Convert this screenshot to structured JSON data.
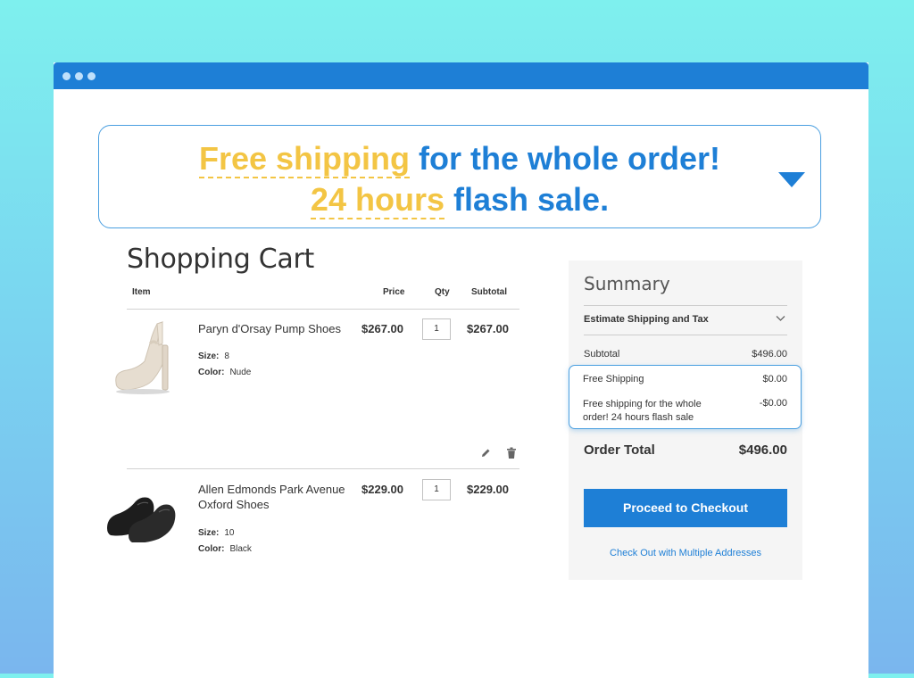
{
  "banner": {
    "line1_highlight": "Free shipping",
    "line1_rest": "for the whole order!",
    "line2_highlight": "24 hours",
    "line2_rest": "flash sale."
  },
  "cart": {
    "title": "Shopping Cart",
    "headers": {
      "item": "Item",
      "price": "Price",
      "qty": "Qty",
      "subtotal": "Subtotal"
    },
    "items": [
      {
        "name": "Paryn d'Orsay Pump Shoes",
        "size_label": "Size:",
        "size": "8",
        "color_label": "Color:",
        "color": "Nude",
        "price": "$267.00",
        "qty": "1",
        "subtotal": "$267.00"
      },
      {
        "name_line1": "Allen Edmonds Park Avenue",
        "name_line2": "Oxford Shoes",
        "size_label": "Size:",
        "size": "10",
        "color_label": "Color:",
        "color": "Black",
        "price": "$229.00",
        "qty": "1",
        "subtotal": "$229.00"
      }
    ],
    "icons": {
      "edit": "pencil-icon",
      "delete": "trash-icon"
    }
  },
  "summary": {
    "title": "Summary",
    "estimate": "Estimate Shipping and Tax",
    "subtotal_label": "Subtotal",
    "subtotal_value": "$496.00",
    "free_shipping_label": "Free Shipping",
    "free_shipping_value": "$0.00",
    "promo_line1": "Free shipping for the whole",
    "promo_line2": "order! 24 hours flash sale",
    "promo_value": "-$0.00",
    "order_total_label": "Order Total",
    "order_total_value": "$496.00",
    "checkout_button": "Proceed to Checkout",
    "multi_link": "Check Out with Multiple Addresses"
  },
  "colors": {
    "accent": "#1e7fd6",
    "highlight": "#f3c544",
    "background_top": "#7ef0ee",
    "background_bottom": "#7ab6ee"
  }
}
